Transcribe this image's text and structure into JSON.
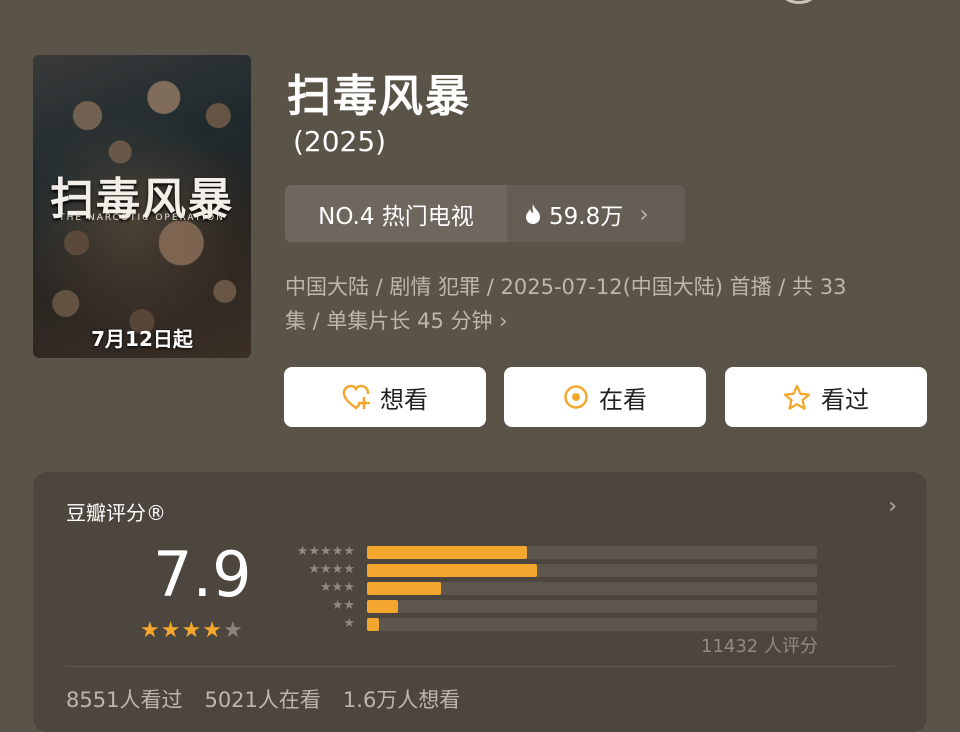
{
  "title": "扫毒风暴",
  "year": "(2025)",
  "poster": {
    "title_text": "扫毒风暴",
    "subtitle_text": "THE NARCOTIC OPERATION",
    "date_text": "7月12日起"
  },
  "rank": {
    "label": "NO.4 热门电视",
    "heat": "59.8万"
  },
  "meta_line1": "中国大陆 / 剧情 犯罪 / 2025-07-12(中国大陆) 首播 / 共 33",
  "meta_line2": "集 / 单集片长 45 分钟",
  "buttons": {
    "want": "想看",
    "watching": "在看",
    "watched": "看过"
  },
  "rating": {
    "title": "豆瓣评分®",
    "score": "7.9",
    "stars_filled": 4,
    "stars_total": 5,
    "count": "11432 人评分",
    "distribution": [
      {
        "stars": 5,
        "fraction": 0.355
      },
      {
        "stars": 4,
        "fraction": 0.378
      },
      {
        "stars": 3,
        "fraction": 0.164
      },
      {
        "stars": 2,
        "fraction": 0.069
      },
      {
        "stars": 1,
        "fraction": 0.027
      }
    ]
  },
  "stats": {
    "watched": "8551人看过",
    "watching": "5021人在看",
    "want": "1.6万人想看"
  },
  "colors": {
    "background": "#5a5348",
    "card": "#4c463e",
    "accent": "#f3a72f"
  }
}
